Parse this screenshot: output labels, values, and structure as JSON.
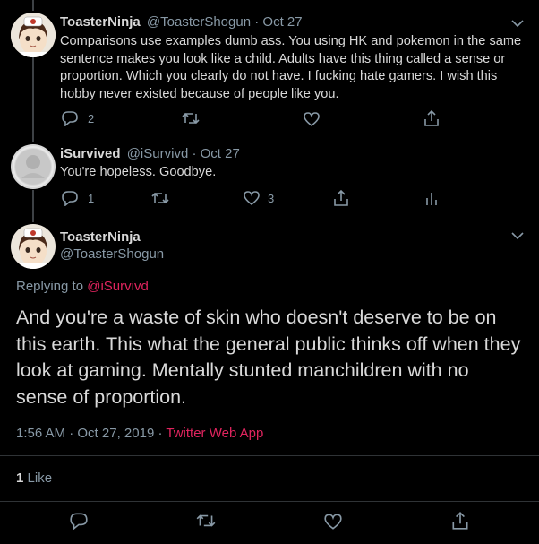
{
  "tweet1": {
    "name": "ToasterNinja",
    "handle": "@ToasterShogun",
    "sep": "·",
    "date": "Oct 27",
    "text": "Comparisons use examples dumb ass. You using HK and pokemon in the same sentence makes you look like a child. Adults have this thing called a sense or proportion. Which you clearly do not have. I fucking hate gamers. I wish this hobby never existed because of people like you.",
    "reply_count": "2",
    "retweet_count": "",
    "like_count": ""
  },
  "tweet2": {
    "name": "iSurvived",
    "handle": "@iSurvivd",
    "sep": "·",
    "date": "Oct 27",
    "text": "You're hopeless. Goodbye.",
    "reply_count": "1",
    "retweet_count": "",
    "like_count": "3"
  },
  "main": {
    "name": "ToasterNinja",
    "handle": "@ToasterShogun",
    "replying_prefix": "Replying to",
    "replying_handle": "@iSurvivd",
    "text": "And you're a waste of skin who doesn't deserve to be on this earth. This what the general public thinks off when they look at gaming. Mentally stunted manchildren with no sense of proportion.",
    "time": "1:56 AM",
    "sep": "·",
    "date": "Oct 27, 2019",
    "sep2": "·",
    "source": "Twitter Web App",
    "likes_count": "1",
    "likes_label": "Like"
  },
  "colors": {
    "background": "#000000",
    "text": "#d9d9d9",
    "muted": "#8899a6",
    "accent": "#e0245e",
    "divider": "#2f3336"
  },
  "icons": [
    "reply-icon",
    "retweet-icon",
    "like-icon",
    "share-icon",
    "analytics-icon",
    "chevron-down-icon"
  ]
}
